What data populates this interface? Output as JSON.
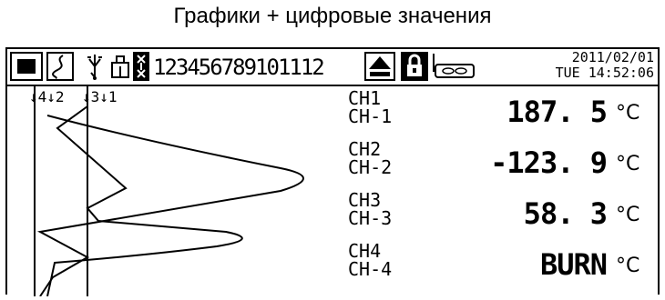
{
  "caption": "Графики + цифровые значения",
  "toolbar": {
    "channels": "123456789101112",
    "date": "2011/02/01",
    "time": "TUE 14:52:06"
  },
  "graph": {
    "markers": [
      "↓4↓2",
      "↓3↓1"
    ]
  },
  "readings": [
    {
      "name": "CH1",
      "tag": "CH-1",
      "value": "187. 5",
      "unit": "°C"
    },
    {
      "name": "CH2",
      "tag": "CH-2",
      "value": "-123. 9",
      "unit": "°C"
    },
    {
      "name": "CH3",
      "tag": "CH-3",
      "value": "58. 3",
      "unit": "°C"
    },
    {
      "name": "CH4",
      "tag": "CH-4",
      "value": "BURN",
      "unit": "°C"
    }
  ],
  "colors": {
    "foreground": "#000000",
    "background": "#ffffff"
  }
}
